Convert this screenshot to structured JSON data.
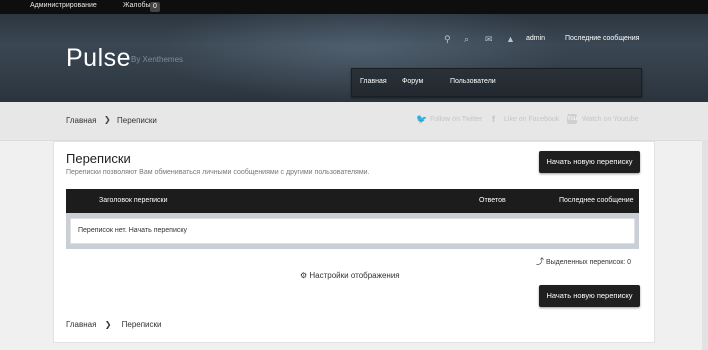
{
  "adminbar": {
    "admin": "Администрирование",
    "reports": "Жалобы:",
    "reports_count": "0"
  },
  "header": {
    "logo": "Pulse",
    "byline": "By Xenthemes",
    "icons": {
      "location": "⚲",
      "search": "⌕",
      "mail": "✉",
      "alerts": "▲"
    },
    "username": "admin",
    "recent_conversations": "Последние сообщения",
    "nav": [
      "Главная",
      "Форум",
      "Пользователи"
    ]
  },
  "crumbs": {
    "home": "Главная",
    "current": "Переписки",
    "sep": "❯"
  },
  "social": {
    "twitter": "Follow on Twitter",
    "facebook": "Like on Facebook",
    "youtube": "Watch on Youtube",
    "icons": {
      "twitter": "🐦",
      "facebook": "f",
      "youtube": "You"
    }
  },
  "main": {
    "title": "Переписки",
    "description": "Переписки позволяют Вам обмениваться личными сообщениями с другими пользователями.",
    "new_button": "Начать новую переписку",
    "table": {
      "headers": [
        "Заголовок переписки",
        "Ответов",
        "Последнее сообщение"
      ],
      "empty": "Переписок нет. Начать переписку"
    },
    "selected": "Выделенных переписок: 0",
    "display_settings": "⚙ Настройки отображения",
    "bottom_crumbs": {
      "home": "Главная",
      "sep": "❯",
      "current": "Переписки"
    }
  }
}
